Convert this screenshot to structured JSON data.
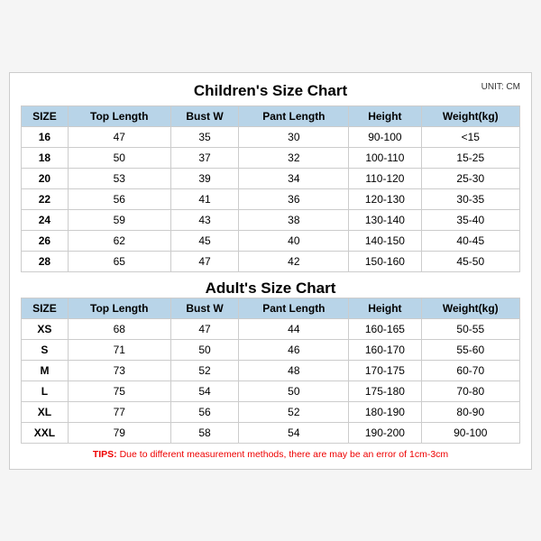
{
  "title": {
    "children": "Children's Size Chart",
    "adults": "Adult's Size Chart",
    "unit": "UNIT: CM"
  },
  "columns": [
    "SIZE",
    "Top Length",
    "Bust W",
    "Pant Length",
    "Height",
    "Weight(kg)"
  ],
  "children_rows": [
    [
      "16",
      "47",
      "35",
      "30",
      "90-100",
      "<15"
    ],
    [
      "18",
      "50",
      "37",
      "32",
      "100-110",
      "15-25"
    ],
    [
      "20",
      "53",
      "39",
      "34",
      "110-120",
      "25-30"
    ],
    [
      "22",
      "56",
      "41",
      "36",
      "120-130",
      "30-35"
    ],
    [
      "24",
      "59",
      "43",
      "38",
      "130-140",
      "35-40"
    ],
    [
      "26",
      "62",
      "45",
      "40",
      "140-150",
      "40-45"
    ],
    [
      "28",
      "65",
      "47",
      "42",
      "150-160",
      "45-50"
    ]
  ],
  "adult_rows": [
    [
      "XS",
      "68",
      "47",
      "44",
      "160-165",
      "50-55"
    ],
    [
      "S",
      "71",
      "50",
      "46",
      "160-170",
      "55-60"
    ],
    [
      "M",
      "73",
      "52",
      "48",
      "170-175",
      "60-70"
    ],
    [
      "L",
      "75",
      "54",
      "50",
      "175-180",
      "70-80"
    ],
    [
      "XL",
      "77",
      "56",
      "52",
      "180-190",
      "80-90"
    ],
    [
      "XXL",
      "79",
      "58",
      "54",
      "190-200",
      "90-100"
    ]
  ],
  "tips": "TIPS: Due to different measurement methods, there are may be an error of 1cm-3cm"
}
